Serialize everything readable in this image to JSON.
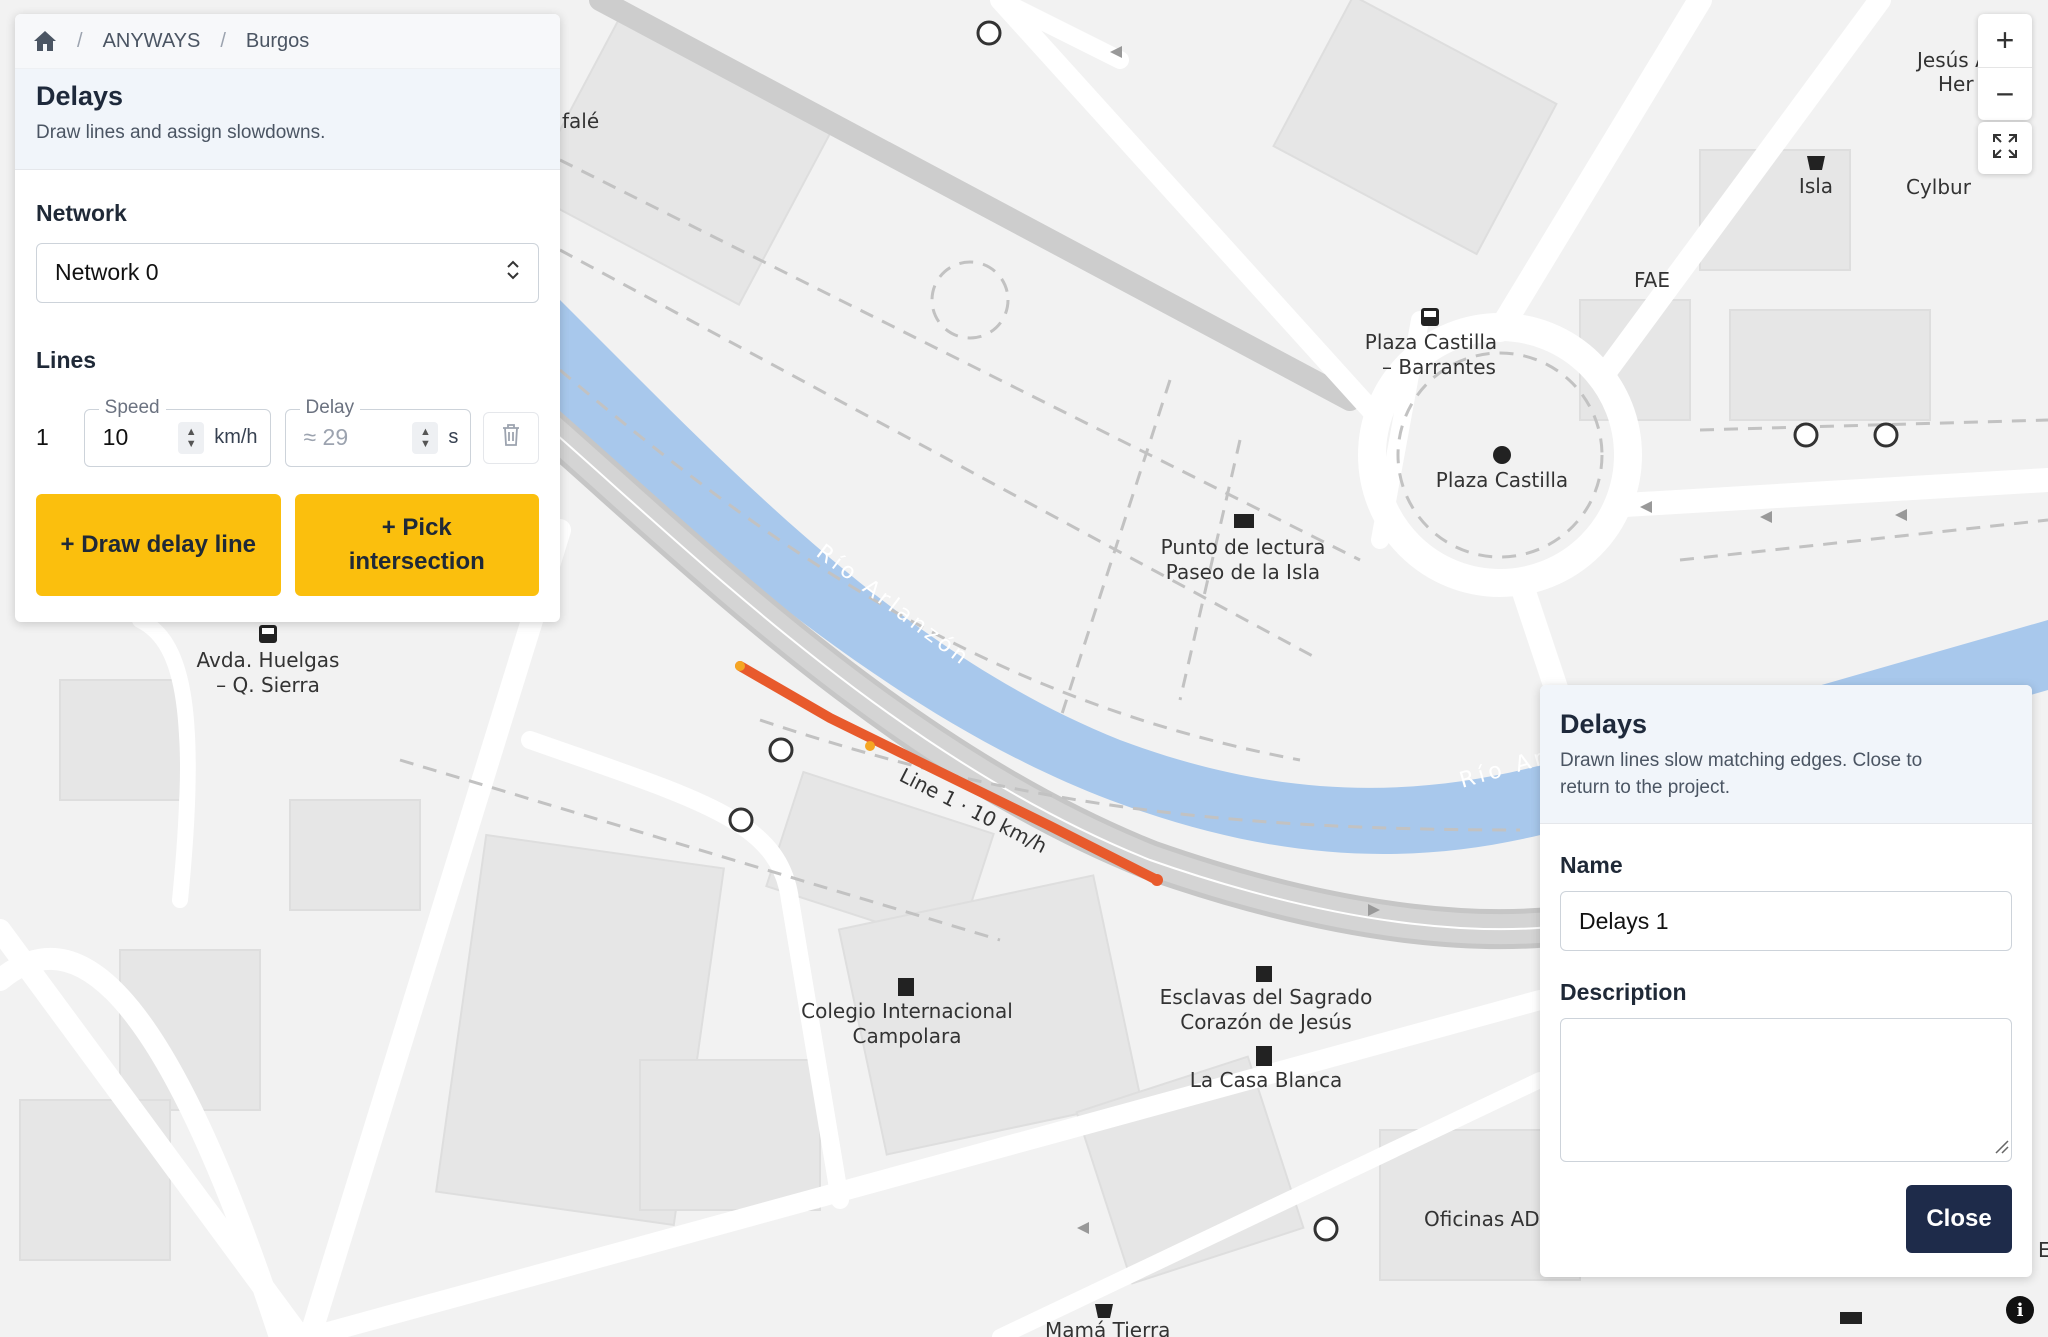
{
  "breadcrumb": {
    "home_icon": "home-icon",
    "items": [
      "ANYWAYS",
      "Burgos"
    ]
  },
  "left_panel": {
    "title": "Delays",
    "subtitle": "Draw lines and assign slowdowns.",
    "network_label": "Network",
    "network_value": "Network 0",
    "lines_label": "Lines",
    "line": {
      "number": "1",
      "speed_label": "Speed",
      "speed_value": "10",
      "speed_unit": "km/h",
      "delay_label": "Delay",
      "delay_value": "≈ 29",
      "delay_unit": "s"
    },
    "draw_button": "+ Draw delay line",
    "pick_button_line1": "+ Pick",
    "pick_button_line2": "intersection"
  },
  "right_panel": {
    "title": "Delays",
    "subtitle_line1": "Drawn lines slow matching edges. Close to",
    "subtitle_line2": "return to the project.",
    "name_label": "Name",
    "name_value": "Delays 1",
    "description_label": "Description",
    "description_value": "",
    "close_button": "Close"
  },
  "map_controls": {
    "zoom_in": "+",
    "zoom_out": "−",
    "fullscreen_icon": "fullscreen-icon",
    "info_icon": "info-icon"
  },
  "map_labels": {
    "river_1": "Río Arlanzón",
    "river_2": "Río Ar",
    "delay_line_label": "Line 1 · 10 km/h",
    "plaza_castilla_stop_1": "Plaza Castilla",
    "plaza_castilla_stop_2": "– Barrantes",
    "plaza_castilla": "Plaza Castilla",
    "punto_lectura_1": "Punto de lectura",
    "punto_lectura_2": "Paseo de la Isla",
    "avda_huelgas_1": "Avda. Huelgas",
    "avda_huelgas_2": "– Q. Sierra",
    "colegio_1": "Colegio Internacional",
    "colegio_2": "Campolara",
    "esclavas_1": "Esclavas del Sagrado",
    "esclavas_2": "Corazón de Jesús",
    "casa_blanca": "La Casa Blanca",
    "oficinas": "Oficinas ADI",
    "isla": "Isla",
    "cylbur": "Cylbur",
    "fae": "FAE",
    "jesus_1": "Jesús A",
    "jesus_2": "Her",
    "falé": "falé",
    "mama_tierra": "Mamá Tierra",
    "edge_e": "E"
  },
  "colors": {
    "river": "#a8c8ec",
    "delay_line": "#e85a2c",
    "accent": "#fbbf0d",
    "dark_button": "#1e2b4a"
  }
}
